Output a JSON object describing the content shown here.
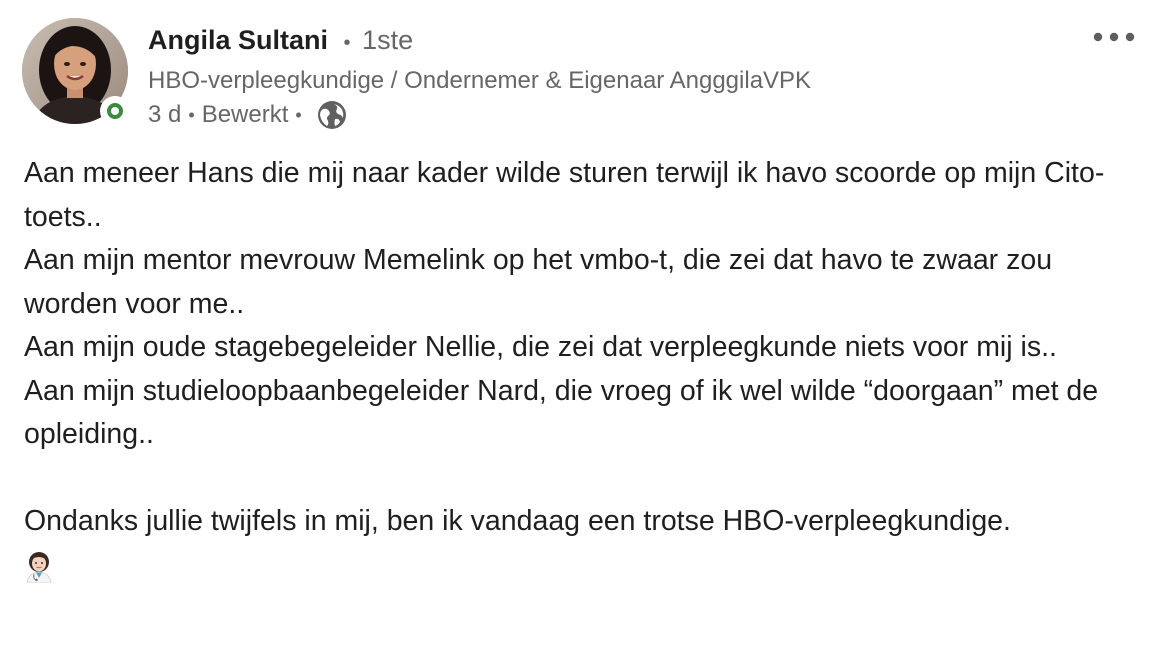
{
  "author": {
    "name": "Angila Sultani",
    "separator_dot": "•",
    "degree": "1ste",
    "headline": "HBO-verpleegkundige / Ondernemer & Eigenaar AngggilaVPK",
    "time": "3 d",
    "edited": "Bewerkt",
    "visibility_icon": "globe-icon",
    "avatar_icon": "profile-photo",
    "status": "online"
  },
  "post": {
    "lines": [
      "Aan meneer Hans die mij naar kader wilde sturen terwijl ik havo scoorde op mijn Cito-toets..",
      "Aan mijn mentor mevrouw Memelink op het vmbo-t, die zei dat havo te zwaar zou worden voor me..",
      "Aan mijn oude stagebegeleider Nellie, die zei dat verpleegkunde niets voor mij is..",
      "Aan mijn studieloopbaanbegeleider Nard, die vroeg of ik wel wilde “doorgaan” met de opleiding.."
    ],
    "closing": "Ondanks jullie twijfels in mij, ben ik vandaag een trotse HBO-verpleegkundige.",
    "closing_emoji_icon": "health-worker-emoji"
  },
  "colors": {
    "text": "#1f1f1f",
    "secondary": "#666666",
    "online": "#3c8a3f"
  },
  "actions": {
    "more_icon": "more-horizontal-icon"
  }
}
